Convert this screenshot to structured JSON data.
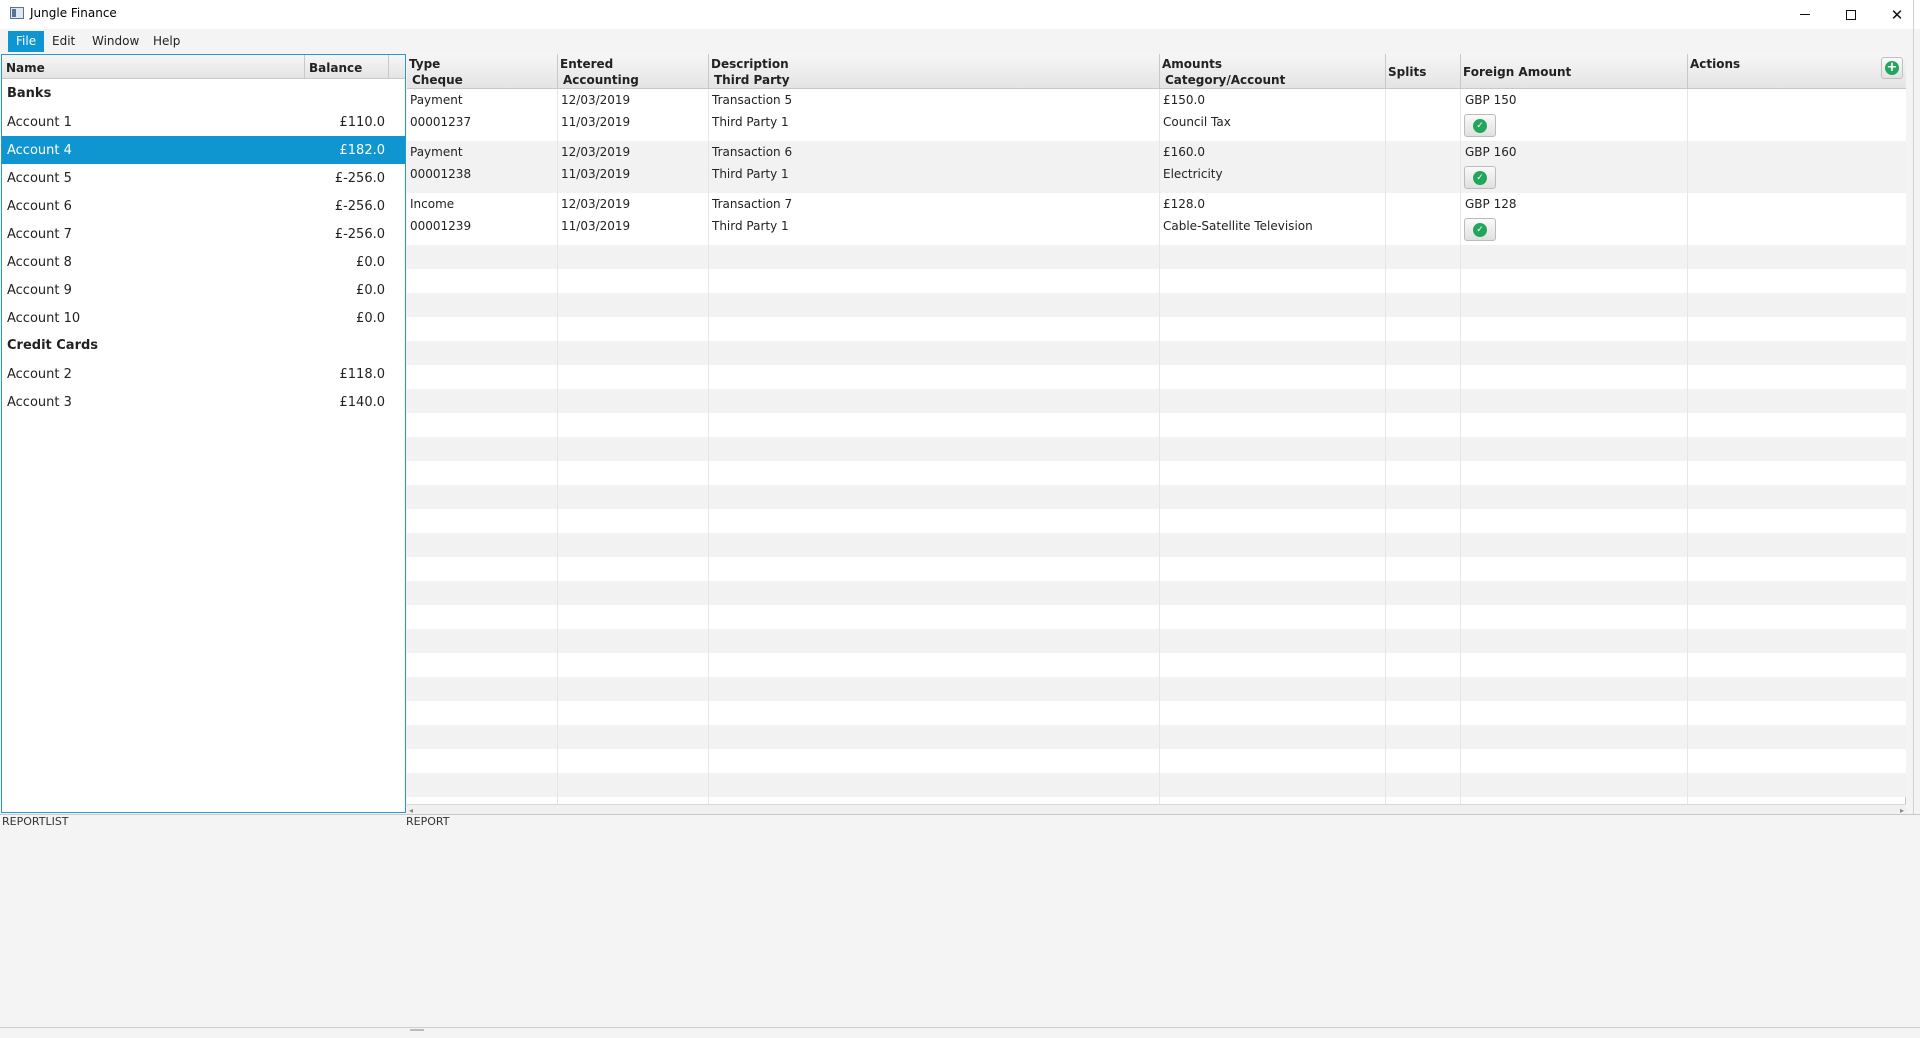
{
  "window": {
    "title": "Jungle Finance",
    "minimize": "",
    "maximize": "",
    "close": "✕"
  },
  "menu": [
    "File",
    "Edit",
    "Window",
    "Help"
  ],
  "accounts": {
    "columns": {
      "name": "Name",
      "balance": "Balance"
    },
    "groups": [
      {
        "label": "Banks",
        "items": [
          {
            "name": "Account 1",
            "balance": "£110.0"
          },
          {
            "name": "Account 4",
            "balance": "£182.0",
            "selected": true
          },
          {
            "name": "Account 5",
            "balance": "£-256.0"
          },
          {
            "name": "Account 6",
            "balance": "£-256.0"
          },
          {
            "name": "Account 7",
            "balance": "£-256.0"
          },
          {
            "name": "Account 8",
            "balance": "£0.0"
          },
          {
            "name": "Account 9",
            "balance": "£0.0"
          },
          {
            "name": "Account 10",
            "balance": "£0.0"
          }
        ]
      },
      {
        "label": "Credit Cards",
        "items": [
          {
            "name": "Account 2",
            "balance": "£118.0"
          },
          {
            "name": "Account 3",
            "balance": "£140.0"
          }
        ]
      }
    ]
  },
  "transactions": {
    "columns": {
      "type": "Type",
      "cheque": "Cheque",
      "entered": "Entered",
      "accounting": "Accounting",
      "description": "Description",
      "third_party": "Third Party",
      "amounts": "Amounts",
      "category": "Category/Account",
      "splits": "Splits",
      "foreign_amount": "Foreign Amount",
      "actions": "Actions"
    },
    "rows": [
      {
        "type": "Payment",
        "cheque": "00001237",
        "entered": "12/03/2019",
        "accounting": "11/03/2019",
        "description": "Transaction 5",
        "third_party": "Third Party 1",
        "amount": "£150.0",
        "category": "Council Tax",
        "foreign_amount": "GBP  150"
      },
      {
        "type": "Payment",
        "cheque": "00001238",
        "entered": "12/03/2019",
        "accounting": "11/03/2019",
        "description": "Transaction 6",
        "third_party": "Third Party 1",
        "amount": "£160.0",
        "category": "Electricity",
        "foreign_amount": "GBP  160"
      },
      {
        "type": "Income",
        "cheque": "00001239",
        "entered": "12/03/2019",
        "accounting": "11/03/2019",
        "description": "Transaction 7",
        "third_party": "Third Party 1",
        "amount": "£128.0",
        "category": "Cable-Satellite Television",
        "foreign_amount": "GBP  128"
      }
    ]
  },
  "bottom": {
    "reportlist": "REPORTLIST",
    "report": "REPORT"
  },
  "colors": {
    "accent": "#0f96d0",
    "confirm": "#22a65b"
  }
}
